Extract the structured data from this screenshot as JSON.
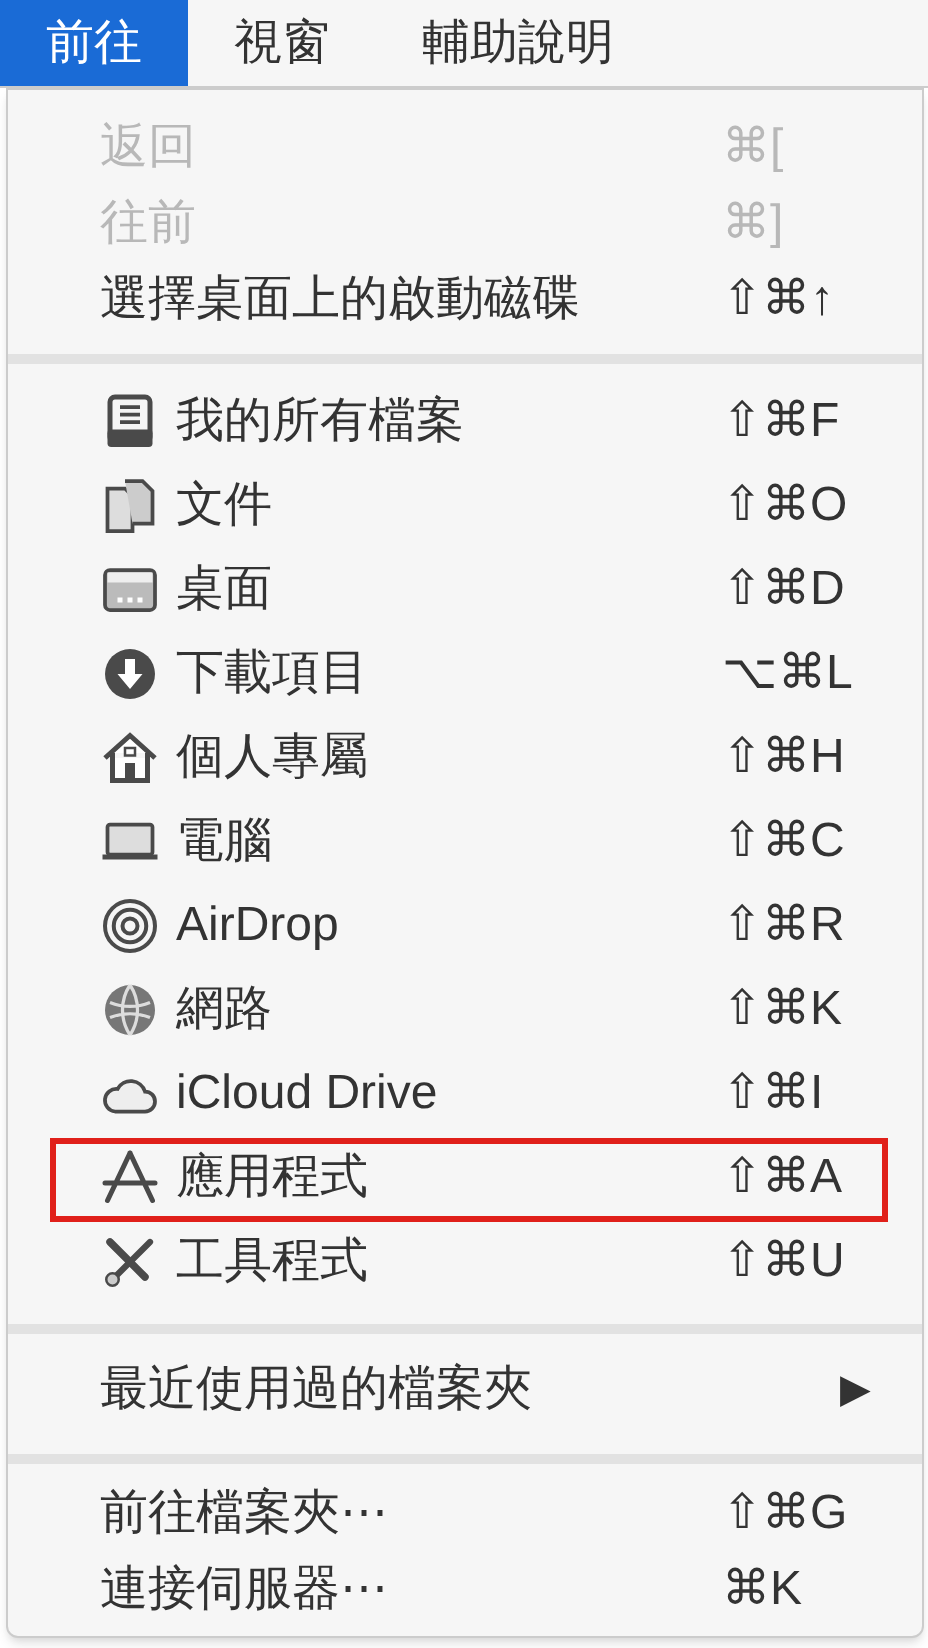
{
  "menu_bar": [
    {
      "label": "前往",
      "selected": true
    },
    {
      "label": "視窗",
      "selected": false
    },
    {
      "label": "輔助說明",
      "selected": false
    }
  ],
  "menu": {
    "groups": [
      {
        "items": [
          {
            "kind": "plain",
            "label": "返回",
            "shortcut": "⌘[",
            "disabled": true,
            "outlined": false
          },
          {
            "kind": "plain",
            "label": "往前",
            "shortcut": "⌘]",
            "disabled": true,
            "outlined": false
          },
          {
            "kind": "plain",
            "label": "選擇桌面上的啟動磁碟",
            "shortcut": "⇧⌘↑",
            "disabled": false,
            "outlined": false
          }
        ]
      },
      {
        "items": [
          {
            "kind": "icon",
            "label": "我的所有檔案",
            "shortcut": "⇧⌘F",
            "disabled": false,
            "outlined": false
          },
          {
            "kind": "icon",
            "label": "文件",
            "shortcut": "⇧⌘O",
            "disabled": false,
            "outlined": false
          },
          {
            "kind": "icon",
            "label": "桌面",
            "shortcut": "⇧⌘D",
            "disabled": false,
            "outlined": false
          },
          {
            "kind": "icon",
            "label": "下載項目",
            "shortcut": "⌥⌘L",
            "disabled": false,
            "outlined": false
          },
          {
            "kind": "icon",
            "label": "個人專屬",
            "shortcut": "⇧⌘H",
            "disabled": false,
            "outlined": false
          },
          {
            "kind": "icon",
            "label": "電腦",
            "shortcut": "⇧⌘C",
            "disabled": false,
            "outlined": false
          },
          {
            "kind": "icon",
            "label": "AirDrop",
            "shortcut": "⇧⌘R",
            "disabled": false,
            "outlined": false
          },
          {
            "kind": "icon",
            "label": "網路",
            "shortcut": "⇧⌘K",
            "disabled": false,
            "outlined": false
          },
          {
            "kind": "icon",
            "label": "iCloud Drive",
            "shortcut": "⇧⌘I",
            "disabled": false,
            "outlined": false
          },
          {
            "kind": "icon",
            "label": "應用程式",
            "shortcut": "⇧⌘A",
            "disabled": false,
            "outlined": true
          },
          {
            "kind": "icon",
            "label": "工具程式",
            "shortcut": "⇧⌘U",
            "disabled": false,
            "outlined": false
          }
        ]
      },
      {
        "items": [
          {
            "kind": "submenu",
            "label": "最近使用過的檔案夾",
            "shortcut": "▶",
            "disabled": false,
            "outlined": false
          }
        ]
      },
      {
        "items": [
          {
            "kind": "plain",
            "label": "前往檔案夾⋯",
            "shortcut": "⇧⌘G",
            "disabled": false,
            "outlined": false
          },
          {
            "kind": "plain",
            "label": "連接伺服器⋯",
            "shortcut": "⌘K",
            "disabled": false,
            "outlined": false
          }
        ]
      }
    ]
  }
}
